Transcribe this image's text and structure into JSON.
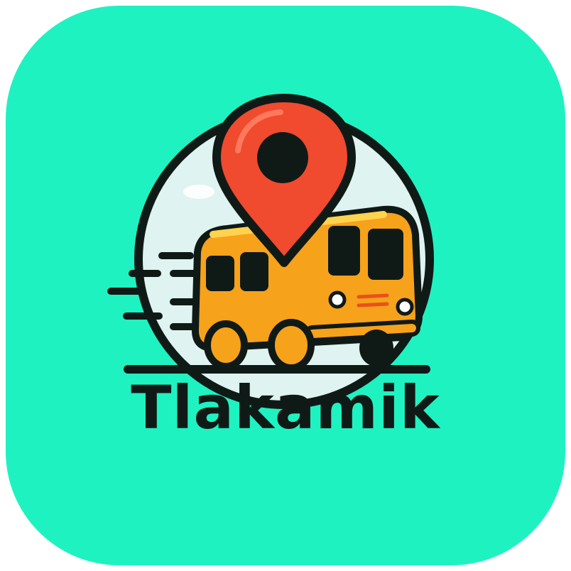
{
  "app": {
    "name": "Tlakamik"
  },
  "icons": {
    "logo": "bus-with-location-pin-logo",
    "pin": "location-pin-icon",
    "bus": "bus-icon",
    "motion": "speed-lines-icon"
  },
  "colors": {
    "background": "#1ff2c1",
    "circle": "#dff3f0",
    "pin": "#f04a2f",
    "bus": "#f7a21b",
    "outline": "#0f1a17",
    "text": "#0f1a17"
  }
}
